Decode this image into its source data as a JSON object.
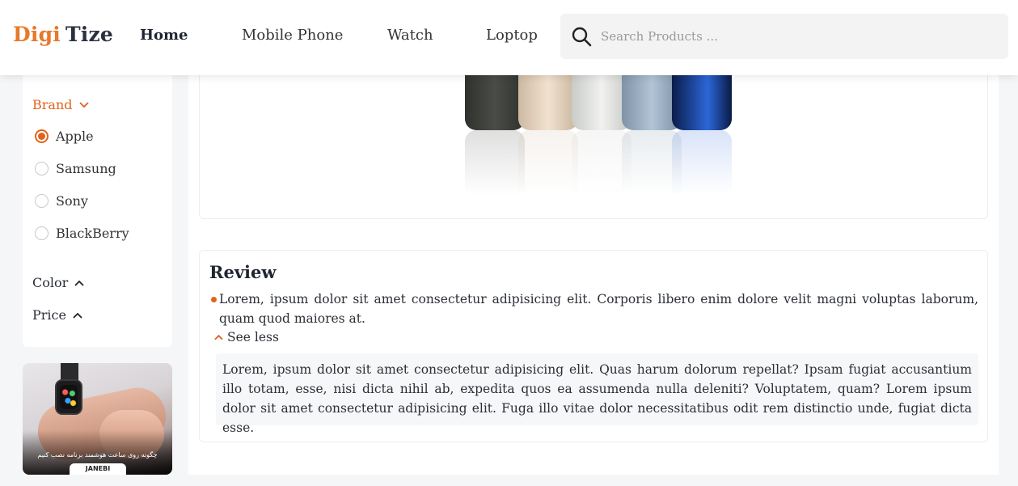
{
  "header": {
    "logo_part1": "Digi",
    "logo_part2": "Tize",
    "nav": [
      {
        "label": "Home",
        "active": true
      },
      {
        "label": "Mobile Phone",
        "active": false
      },
      {
        "label": "Watch",
        "active": false
      },
      {
        "label": "Loptop",
        "active": false
      }
    ],
    "search": {
      "placeholder": "Search Products ...",
      "value": "",
      "icon": "search-icon"
    }
  },
  "filters": {
    "brand": {
      "title": "Brand",
      "expanded": true,
      "options": [
        {
          "label": "Apple",
          "checked": true
        },
        {
          "label": "Samsung",
          "checked": false
        },
        {
          "label": "Sony",
          "checked": false
        },
        {
          "label": "BlackBerry",
          "checked": false
        }
      ]
    },
    "color": {
      "title": "Color",
      "expanded": false
    },
    "price": {
      "title": "Price",
      "expanded": false
    }
  },
  "promo": {
    "caption": "چگونه روی ساعت هوشمند برنامه نصب کنیم",
    "tag": "JANEBI"
  },
  "review": {
    "title": "Review",
    "summary": "Lorem, ipsum dolor sit amet consectetur adipisicing elit. Corporis libero enim dolore velit magni voluptas laborum, quam quod maiores at.",
    "toggle_label": "See less",
    "detail": "Lorem, ipsum dolor sit amet consectetur adipisicing elit. Quas harum dolorum repellat? Ipsam fugiat accusantium illo totam, esse, nisi dicta nihil ab, expedita quos ea assumenda nulla deleniti? Voluptatem, quam? Lorem ipsum dolor sit amet consectetur adipisicing elit. Fuga illo vitae dolor necessitatibus odit rem distinctio unde, fugiat dicta esse."
  },
  "colors": {
    "accent": "#e2621b",
    "logo_accent": "#e8782b",
    "phones": [
      "#3c3f3a",
      "#e9d7c3",
      "#e5e6e3",
      "#9fb3c8",
      "#1a3f8f"
    ]
  }
}
